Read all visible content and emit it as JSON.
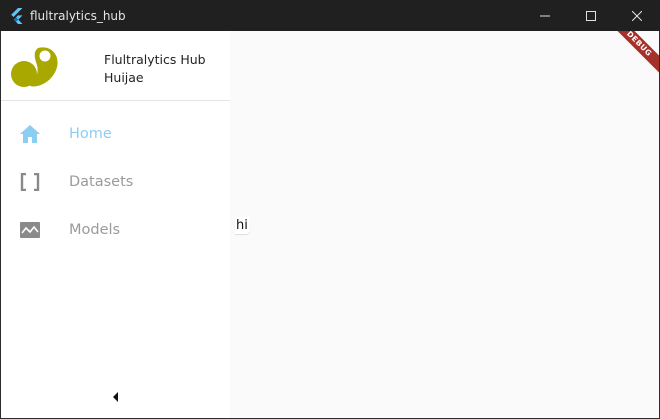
{
  "window": {
    "title": "flultralytics_hub",
    "controls": {
      "minimize": "minimize-icon",
      "maximize": "maximize-icon",
      "close": "close-icon"
    }
  },
  "sidebar": {
    "header": {
      "app_name": "Flultralytics Hub",
      "user_name": "Huijae",
      "logo_color": "#a8a800"
    },
    "items": [
      {
        "label": "Home",
        "icon": "home-icon",
        "active": true
      },
      {
        "label": "Datasets",
        "icon": "brackets-icon",
        "active": false
      },
      {
        "label": "Models",
        "icon": "image-wave-icon",
        "active": false
      }
    ],
    "collapse_icon": "chevron-left-icon"
  },
  "main": {
    "text": "hi"
  },
  "debug_banner": "DEBUG",
  "colors": {
    "active": "#8ccdf2",
    "inactive": "#9a9a9a",
    "banner": "#a6312b"
  }
}
